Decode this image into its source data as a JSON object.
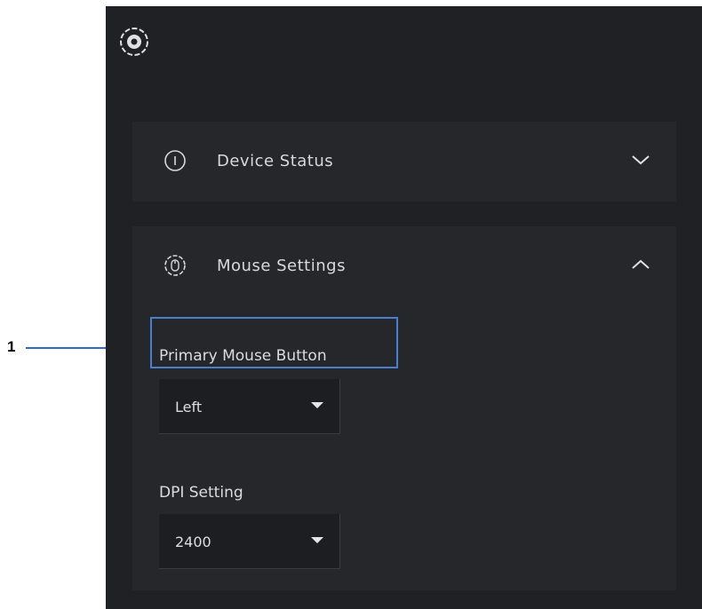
{
  "callout": {
    "number": "1"
  },
  "device_status": {
    "title": "Device Status",
    "icon": "info-icon",
    "expanded": false
  },
  "mouse_settings": {
    "title": "Mouse Settings",
    "icon": "mouse-icon",
    "expanded": true,
    "primary_button": {
      "label": "Primary Mouse Button",
      "value": "Left"
    },
    "dpi": {
      "label": "DPI Setting",
      "value": "2400"
    }
  },
  "colors": {
    "panel_bg": "#1f2124",
    "section_bg": "#25272a",
    "highlight": "#4a7fd0"
  }
}
